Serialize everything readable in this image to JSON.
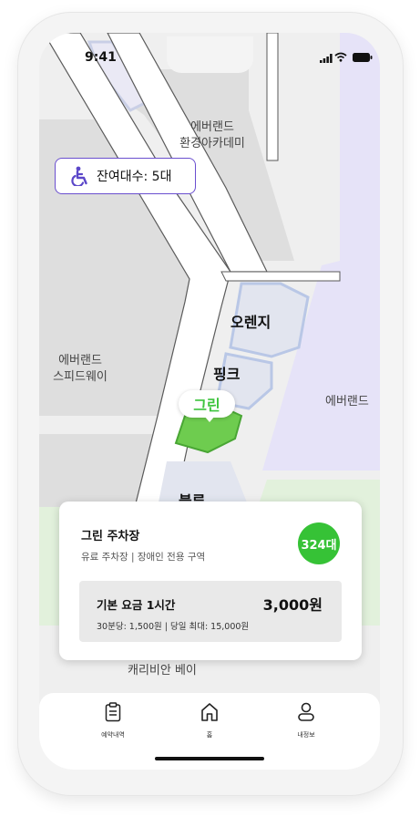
{
  "status_bar": {
    "time": "9:41"
  },
  "map": {
    "labels": {
      "everland_academy_line1": "에버랜드",
      "everland_academy_line2": "환경아카데미",
      "speedway_line1": "에버랜드",
      "speedway_line2": "스피드웨이",
      "everland_right": "에버랜드",
      "caribbean_bay": "캐리비안 베이"
    },
    "lots": {
      "orange": "오렌지",
      "pink": "핑크",
      "green": "그린",
      "blue": "블루"
    },
    "accessible_badge": {
      "icon": "wheelchair-icon",
      "text": "잔여대수: 5대"
    }
  },
  "lot_card": {
    "title": "그린 주차장",
    "subtitle": "유료 주차장 | 장애인 전용 구역",
    "available_count": "324대",
    "fee_label": "기본 요금 1시간",
    "fee_amount": "3,000원",
    "fee_detail": "30분당: 1,500원 | 당일 최대: 15,000원"
  },
  "tab_bar": {
    "items": [
      {
        "label": "예약내역",
        "icon": "clipboard-icon"
      },
      {
        "label": "홈",
        "icon": "home-icon"
      },
      {
        "label": "내정보",
        "icon": "user-icon"
      }
    ]
  },
  "colors": {
    "accent_green": "#36c236",
    "badge_border": "#6a4fcf",
    "map_purple": "#e6e3f8",
    "map_green": "#e2f1dc"
  }
}
